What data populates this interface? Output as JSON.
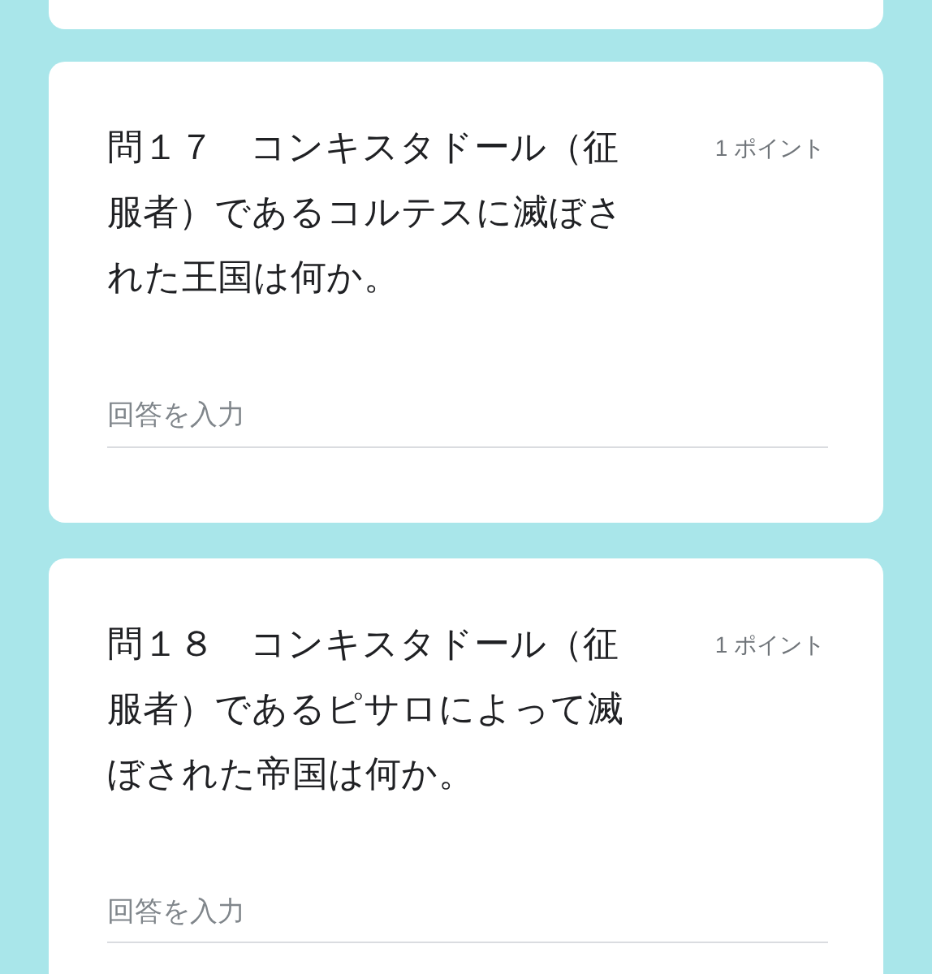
{
  "questions": [
    {
      "text": "問１７　コンキスタドール（征服者）であるコルテスに滅ぼされた王国は何か。",
      "points": "1 ポイント",
      "placeholder": "回答を入力"
    },
    {
      "text": "問１８　コンキスタドール（征服者）であるピサロによって滅ぼされた帝国は何か。",
      "points": "1 ポイント",
      "placeholder": "回答を入力"
    }
  ]
}
